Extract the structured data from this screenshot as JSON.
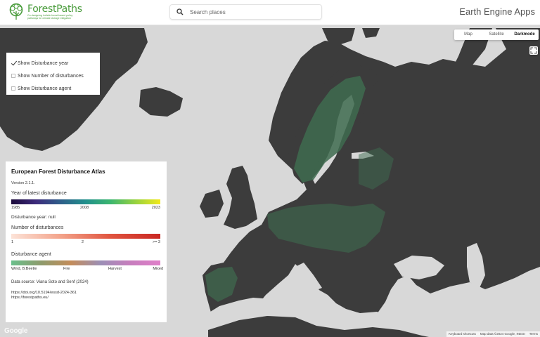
{
  "header": {
    "logo_name": "ForestPaths",
    "logo_tagline": "Co-designing holistic forest-based policy pathways for climate change mitigation",
    "search_placeholder": "Search places",
    "app_title": "Earth Engine Apps"
  },
  "map_controls": {
    "map_types": [
      "Map",
      "Satellite",
      "Darkmode"
    ],
    "active_map_type": "Darkmode",
    "fullscreen_icon": "fullscreen-icon"
  },
  "layers": {
    "items": [
      {
        "label": "Show Disturbance year",
        "checked": true
      },
      {
        "label": "Show Number of disturbances",
        "checked": false
      },
      {
        "label": "Show Disturbance agent",
        "checked": false
      }
    ]
  },
  "legend": {
    "title": "European Forest Disturbance Atlas",
    "version": "Version 2.1.1.",
    "year_title": "Year of latest disturbance",
    "year_ticks": [
      "1985",
      "2008",
      "2023"
    ],
    "year_colors": [
      "#1b0a3a",
      "#21908c",
      "#f2e91b"
    ],
    "disturbance_year_value": "Disturbance year: null",
    "num_title": "Number of disturbances",
    "num_ticks": [
      "1",
      "2",
      ">= 3"
    ],
    "num_colors": [
      "#fce3d8",
      "#c92722"
    ],
    "agent_title": "Disturbance agent",
    "agent_ticks": [
      "Wind, B.Beetle",
      "Fire",
      "Harvest",
      "Mixed"
    ],
    "agent_colors": [
      "#6abf8c",
      "#c38c5a",
      "#9c8fb6",
      "#e07fc9"
    ],
    "source": "Data source: Viana Soto and Senf (2024)",
    "doi": "https://doi.org/10.5194/essd-2024-361",
    "url": "https://forestpaths.eu/"
  },
  "footer": {
    "google_logo": "Google",
    "keyboard_shortcuts": "Keyboard shortcuts",
    "map_data": "Map data ©2024 Google, INEGI",
    "terms": "Terms"
  },
  "colors": {
    "land": "#3c3c3c",
    "water": "#d8d8d8",
    "forest": "#3e6b4f",
    "brand_green": "#4a9c3c"
  }
}
